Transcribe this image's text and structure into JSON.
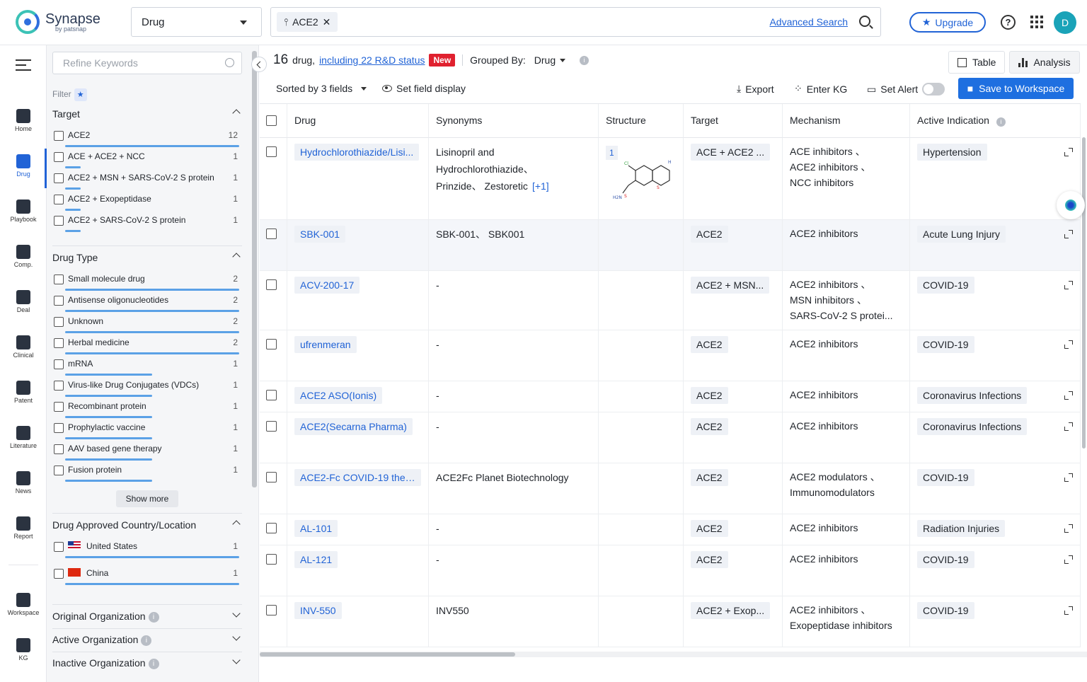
{
  "header": {
    "logo_text": "Synapse",
    "logo_sub": "by patsnap",
    "type_select": "Drug",
    "search_chip": "ACE2",
    "advanced_search": "Advanced Search",
    "upgrade": "Upgrade",
    "avatar": "D"
  },
  "nav": {
    "items": [
      {
        "label": "Home",
        "icon": "home-icon"
      },
      {
        "label": "Drug",
        "icon": "pill-icon"
      },
      {
        "label": "Playbook",
        "icon": "playbook-icon"
      },
      {
        "label": "Comp.",
        "icon": "competition-icon"
      },
      {
        "label": "Deal",
        "icon": "deal-icon"
      },
      {
        "label": "Clinical",
        "icon": "clinical-icon"
      },
      {
        "label": "Patent",
        "icon": "patent-icon"
      },
      {
        "label": "Literature",
        "icon": "literature-icon"
      },
      {
        "label": "News",
        "icon": "news-icon"
      },
      {
        "label": "Report",
        "icon": "report-icon"
      },
      {
        "label": "Workspace",
        "icon": "workspace-icon"
      },
      {
        "label": "KG",
        "icon": "kg-icon"
      }
    ],
    "active": "Drug"
  },
  "filters": {
    "refine_placeholder": "Refine Keywords",
    "filter_label": "Filter",
    "target": {
      "title": "Target",
      "items": [
        {
          "label": "ACE2",
          "count": "12",
          "fill": 1.0
        },
        {
          "label": "ACE + ACE2 + NCC",
          "count": "1",
          "fill": 0.08
        },
        {
          "label": "ACE2 + MSN + SARS-CoV-2 S protein",
          "count": "1",
          "fill": 0.08
        },
        {
          "label": "ACE2 + Exopeptidase",
          "count": "1",
          "fill": 0.08
        },
        {
          "label": "ACE2 + SARS-CoV-2 S protein",
          "count": "1",
          "fill": 0.08
        }
      ]
    },
    "drug_type": {
      "title": "Drug Type",
      "items": [
        {
          "label": "Small molecule drug",
          "count": "2",
          "fill": 1.0
        },
        {
          "label": "Antisense oligonucleotides",
          "count": "2",
          "fill": 1.0
        },
        {
          "label": "Unknown",
          "count": "2",
          "fill": 1.0
        },
        {
          "label": "Herbal medicine",
          "count": "2",
          "fill": 1.0
        },
        {
          "label": "mRNA",
          "count": "1",
          "fill": 0.5
        },
        {
          "label": "Virus-like Drug Conjugates (VDCs)",
          "count": "1",
          "fill": 0.5
        },
        {
          "label": "Recombinant protein",
          "count": "1",
          "fill": 0.5
        },
        {
          "label": "Prophylactic vaccine",
          "count": "1",
          "fill": 0.5
        },
        {
          "label": "AAV based gene therapy",
          "count": "1",
          "fill": 0.5
        },
        {
          "label": "Fusion protein",
          "count": "1",
          "fill": 0.5
        }
      ],
      "show_more": "Show more"
    },
    "country": {
      "title": "Drug Approved Country/Location",
      "items": [
        {
          "label": "United States",
          "count": "1",
          "flag": "us",
          "fill": 1.0
        },
        {
          "label": "China",
          "count": "1",
          "flag": "cn",
          "fill": 1.0
        }
      ]
    },
    "collapsed": [
      "Original Organization",
      "Active Organization",
      "Inactive Organization"
    ]
  },
  "summary": {
    "count": "16",
    "unit": "drug,",
    "link": "including 22 R&D status",
    "badge": "New",
    "grouped_label": "Grouped By:",
    "grouped_value": "Drug"
  },
  "view_tabs": [
    "Table",
    "Analysis"
  ],
  "toolbar": {
    "sorted": "Sorted by 3 fields",
    "field_display": "Set field display",
    "export": "Export",
    "enter_kg": "Enter KG",
    "set_alert": "Set Alert",
    "save": "Save to Workspace"
  },
  "table": {
    "columns": [
      "Drug",
      "Synonyms",
      "Structure",
      "Target",
      "Mechanism",
      "Active Indication"
    ],
    "rows": [
      {
        "drug": "Hydrochlorothiazide/Lisi...",
        "syn1": "Lisinopril and",
        "syn2": "Hydrochlorothiazide、",
        "syn3": "Prinzide、 Zestoretic",
        "syn_more": "[+1]",
        "structure": "1",
        "target": "ACE + ACE2 ...",
        "mech": [
          "ACE inhibitors 、",
          "ACE2 inhibitors 、",
          "NCC inhibitors"
        ],
        "ind": "Hypertension"
      },
      {
        "drug": "SBK-001",
        "syn1": "SBK-001、 SBK001",
        "target": "ACE2",
        "mech": [
          "ACE2 inhibitors"
        ],
        "ind": "Acute Lung Injury"
      },
      {
        "drug": "ACV-200-17",
        "syn1": "-",
        "target": "ACE2 + MSN...",
        "mech": [
          "ACE2 inhibitors 、",
          "MSN inhibitors 、",
          "SARS-CoV-2 S protei..."
        ],
        "ind": "COVID-19"
      },
      {
        "drug": "ufrenmeran",
        "syn1": "-",
        "target": "ACE2",
        "mech": [
          "ACE2 inhibitors"
        ],
        "ind": "COVID-19"
      },
      {
        "drug": "ACE2 ASO(Ionis)",
        "syn1": "-",
        "target": "ACE2",
        "mech": [
          "ACE2 inhibitors"
        ],
        "ind": "Coronavirus Infections"
      },
      {
        "drug": "ACE2(Secarna Pharma)",
        "syn1": "-",
        "target": "ACE2",
        "mech": [
          "ACE2 inhibitors"
        ],
        "ind": "Coronavirus Infections"
      },
      {
        "drug": "ACE2-Fc COVID-19 thera...",
        "syn1": "ACE2Fc Planet Biotechnology",
        "target": "ACE2",
        "mech": [
          "ACE2 modulators 、",
          "Immunomodulators"
        ],
        "ind": "COVID-19"
      },
      {
        "drug": "AL-101",
        "syn1": "-",
        "target": "ACE2",
        "mech": [
          "ACE2 inhibitors"
        ],
        "ind": "Radiation Injuries"
      },
      {
        "drug": "AL-121",
        "syn1": "-",
        "target": "ACE2",
        "mech": [
          "ACE2 inhibitors"
        ],
        "ind": "COVID-19"
      },
      {
        "drug": "INV-550",
        "syn1": "INV550",
        "target": "ACE2 + Exop...",
        "mech": [
          "ACE2 inhibitors 、",
          "Exopeptidase inhibitors"
        ],
        "ind": "COVID-19"
      }
    ]
  }
}
